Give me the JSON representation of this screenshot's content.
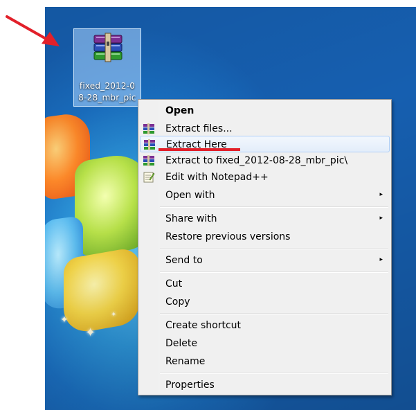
{
  "desktop": {
    "icon": {
      "name": "rar-archive-icon",
      "label_line1": "fixed_2012-0",
      "label_line2": "8-28_mbr_pic"
    }
  },
  "context_menu": {
    "items": [
      {
        "label": "Open",
        "bold": true,
        "icon": ""
      },
      {
        "label": "Extract files...",
        "icon": "winrar-icon"
      },
      {
        "label": "Extract Here",
        "icon": "winrar-icon",
        "highlighted": true
      },
      {
        "label": "Extract to fixed_2012-08-28_mbr_pic\\",
        "icon": "winrar-icon"
      },
      {
        "label": "Edit with Notepad++",
        "icon": "notepad-plus-plus-icon"
      },
      {
        "label": "Open with",
        "submenu": true
      },
      {
        "label": "Share with",
        "submenu": true
      },
      {
        "label": "Restore previous versions"
      },
      {
        "label": "Send to",
        "submenu": true
      },
      {
        "label": "Cut"
      },
      {
        "label": "Copy"
      },
      {
        "label": "Create shortcut"
      },
      {
        "label": "Delete"
      },
      {
        "label": "Rename"
      },
      {
        "label": "Properties"
      }
    ],
    "submenu_arrow": "▸"
  },
  "colors": {
    "annotation": "#e2202a",
    "desktop_blue": "#1a6fc1",
    "menu_bg": "#f0f0f0",
    "hover_border": "#aecff7"
  }
}
